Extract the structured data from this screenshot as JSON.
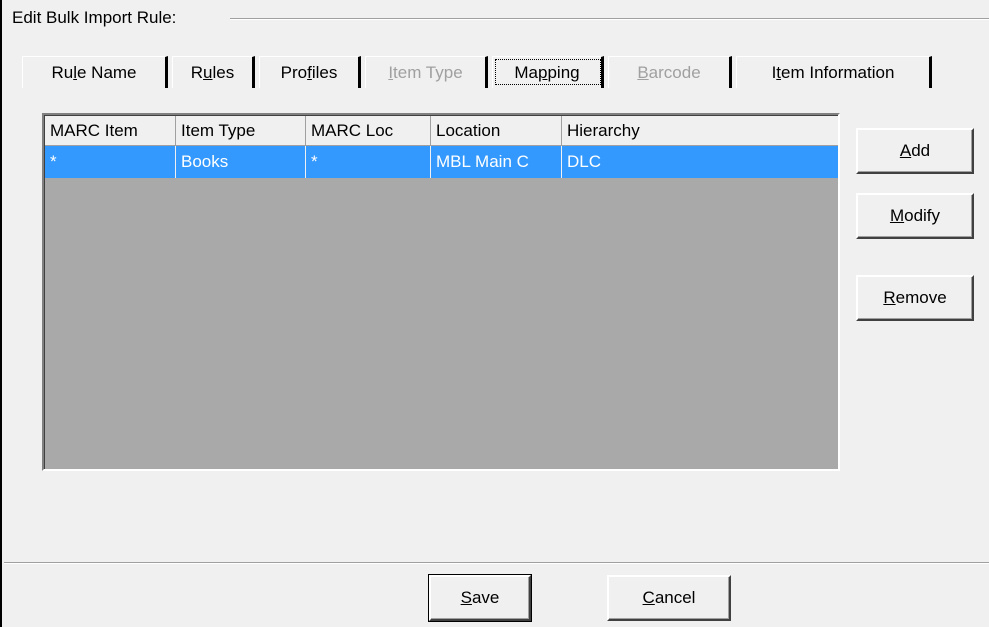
{
  "group": {
    "title": "Edit Bulk Import Rule:"
  },
  "tabs": [
    {
      "label_pre": "Ru",
      "label_u": "l",
      "label_post": "e Name",
      "disabled": false
    },
    {
      "label_pre": "R",
      "label_u": "u",
      "label_post": "les",
      "disabled": false
    },
    {
      "label_pre": "Pro",
      "label_u": "f",
      "label_post": "iles",
      "disabled": false
    },
    {
      "label_pre": "",
      "label_u": "I",
      "label_post": "tem Type",
      "disabled": true
    },
    {
      "label_pre": "Ma",
      "label_u": "p",
      "label_post": "ping",
      "disabled": false,
      "active": true
    },
    {
      "label_pre": "",
      "label_u": "B",
      "label_post": "arcode",
      "disabled": true
    },
    {
      "label_pre": "I",
      "label_u": "t",
      "label_post": "em Information",
      "disabled": false
    }
  ],
  "mapping_table": {
    "columns": [
      "MARC Item",
      "Item Type",
      "MARC Loc",
      "Location",
      "Hierarchy"
    ],
    "rows": [
      [
        "*",
        "Books",
        "*",
        "MBL Main C",
        "DLC"
      ]
    ]
  },
  "side_buttons": {
    "add": {
      "u": "A",
      "rest": "dd"
    },
    "modify": {
      "u": "M",
      "rest": "odify"
    },
    "remove": {
      "u": "R",
      "rest": "emove"
    }
  },
  "footer_buttons": {
    "save": {
      "u": "S",
      "rest": "ave"
    },
    "cancel": {
      "u": "C",
      "rest": "ancel"
    }
  }
}
